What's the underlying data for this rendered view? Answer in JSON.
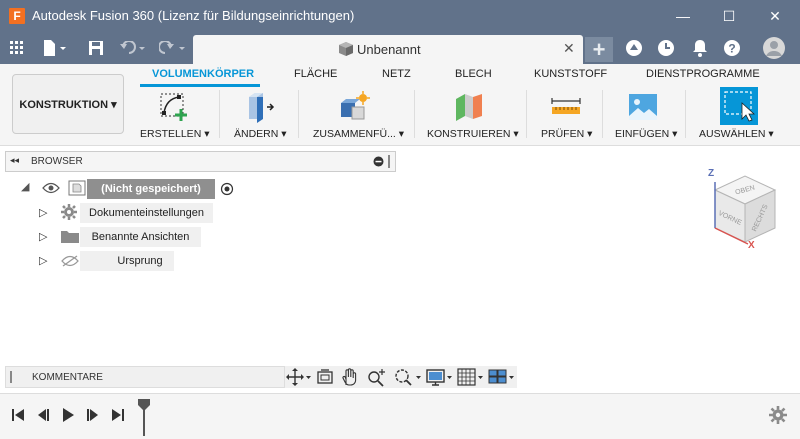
{
  "window": {
    "title": "Autodesk Fusion 360 (Lizenz für Bildungseinrichtungen)",
    "logo_letter": "F",
    "minimize": "—",
    "maximize": "☐",
    "close": "✕"
  },
  "document_tab": {
    "label": "Unbenannt",
    "close": "✕"
  },
  "ribbon": {
    "workspace": "KONSTRUKTION ▾",
    "tabs": [
      "VOLUMENKÖRPER",
      "FLÄCHE",
      "NETZ",
      "BLECH",
      "KUNSTSTOFF",
      "DIENSTPROGRAMME"
    ],
    "active_tab": "VOLUMENKÖRPER",
    "groups": [
      "ERSTELLEN ▾",
      "ÄNDERN ▾",
      "ZUSAMMENFÜ... ▾",
      "KONSTRUIEREN ▾",
      "PRÜFEN ▾",
      "EINFÜGEN ▾",
      "AUSWÄHLEN ▾"
    ]
  },
  "browser": {
    "title": "BROWSER",
    "root": "(Nicht gespeichert)",
    "items": [
      "Dokumenteinstellungen",
      "Benannte Ansichten",
      "Ursprung"
    ]
  },
  "viewcube": {
    "top": "OBEN",
    "front": "VORNE",
    "right": "RECHTS",
    "axis_z": "Z",
    "axis_x": "X"
  },
  "comments": {
    "title": "KOMMENTARE"
  },
  "colors": {
    "titlebar": "#61728a",
    "accent": "#0696d7",
    "brand": "#f37021"
  }
}
